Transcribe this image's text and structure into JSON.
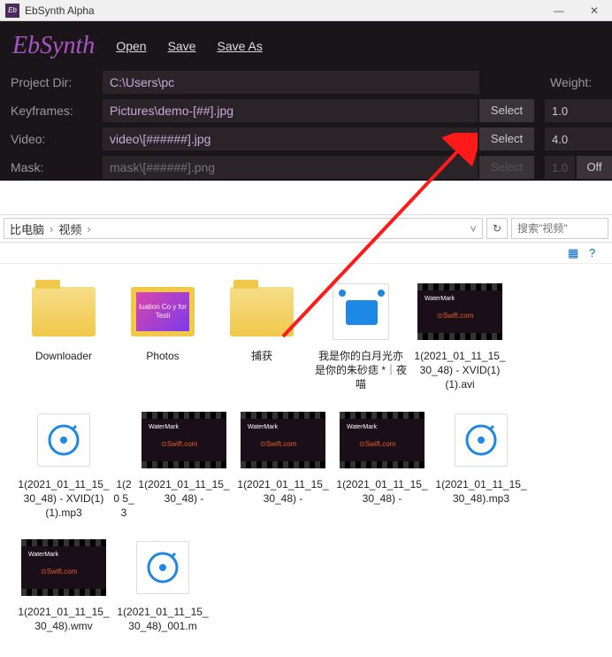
{
  "window": {
    "title": "EbSynth Alpha",
    "min_icon": "—",
    "close_icon": "✕"
  },
  "app": {
    "logo": "EbSynth",
    "menu": {
      "open": "Open",
      "save": "Save",
      "save_as": "Save As"
    },
    "labels": {
      "project_dir": "Project Dir:",
      "keyframes": "Keyframes:",
      "video": "Video:",
      "mask": "Mask:",
      "weight": "Weight:",
      "select": "Select",
      "off": "Off"
    },
    "values": {
      "project_dir": "C:\\Users\\pc",
      "keyframes": "Pictures\\demo-[##].jpg",
      "video": "video\\[######].jpg",
      "mask_placeholder": "mask\\[######].png",
      "weight_keyframes": "1.0",
      "weight_video": "4.0",
      "weight_mask": "1.0"
    }
  },
  "explorer": {
    "breadcrumb": [
      "比电脑",
      "视频"
    ],
    "search_placeholder": "搜索\"视频\"",
    "files_row1": [
      {
        "type": "folder",
        "label": "Downloader"
      },
      {
        "type": "folder-photo",
        "label": "Photos",
        "inner": "luation Co\ny for Testi"
      },
      {
        "type": "folder",
        "label": "捕获"
      },
      {
        "type": "video-generic",
        "label": "我是你的白月光亦是你的朱砂痣 *｜夜喵"
      },
      {
        "type": "video-thumb",
        "label": "1(2021_01_11_15_30_48) - XVID(1)(1).avi"
      },
      {
        "type": "audio",
        "label": "1(2021_01_11_15_30_48) - XVID(1)(1).mp3"
      },
      {
        "type": "partial",
        "label": "1(20\n5_3"
      }
    ],
    "files_row2": [
      {
        "type": "video-thumb",
        "label": "1(2021_01_11_15_30_48) -"
      },
      {
        "type": "video-thumb",
        "label": "1(2021_01_11_15_30_48) -"
      },
      {
        "type": "video-thumb",
        "label": "1(2021_01_11_15_30_48) -"
      },
      {
        "type": "audio",
        "label": "1(2021_01_11_15_30_48).mp3"
      },
      {
        "type": "video-thumb",
        "label": "1(2021_01_11_15_30_48).wmv"
      },
      {
        "type": "audio",
        "label": "1(2021_01_11_15_30_48)_001.m"
      }
    ]
  }
}
